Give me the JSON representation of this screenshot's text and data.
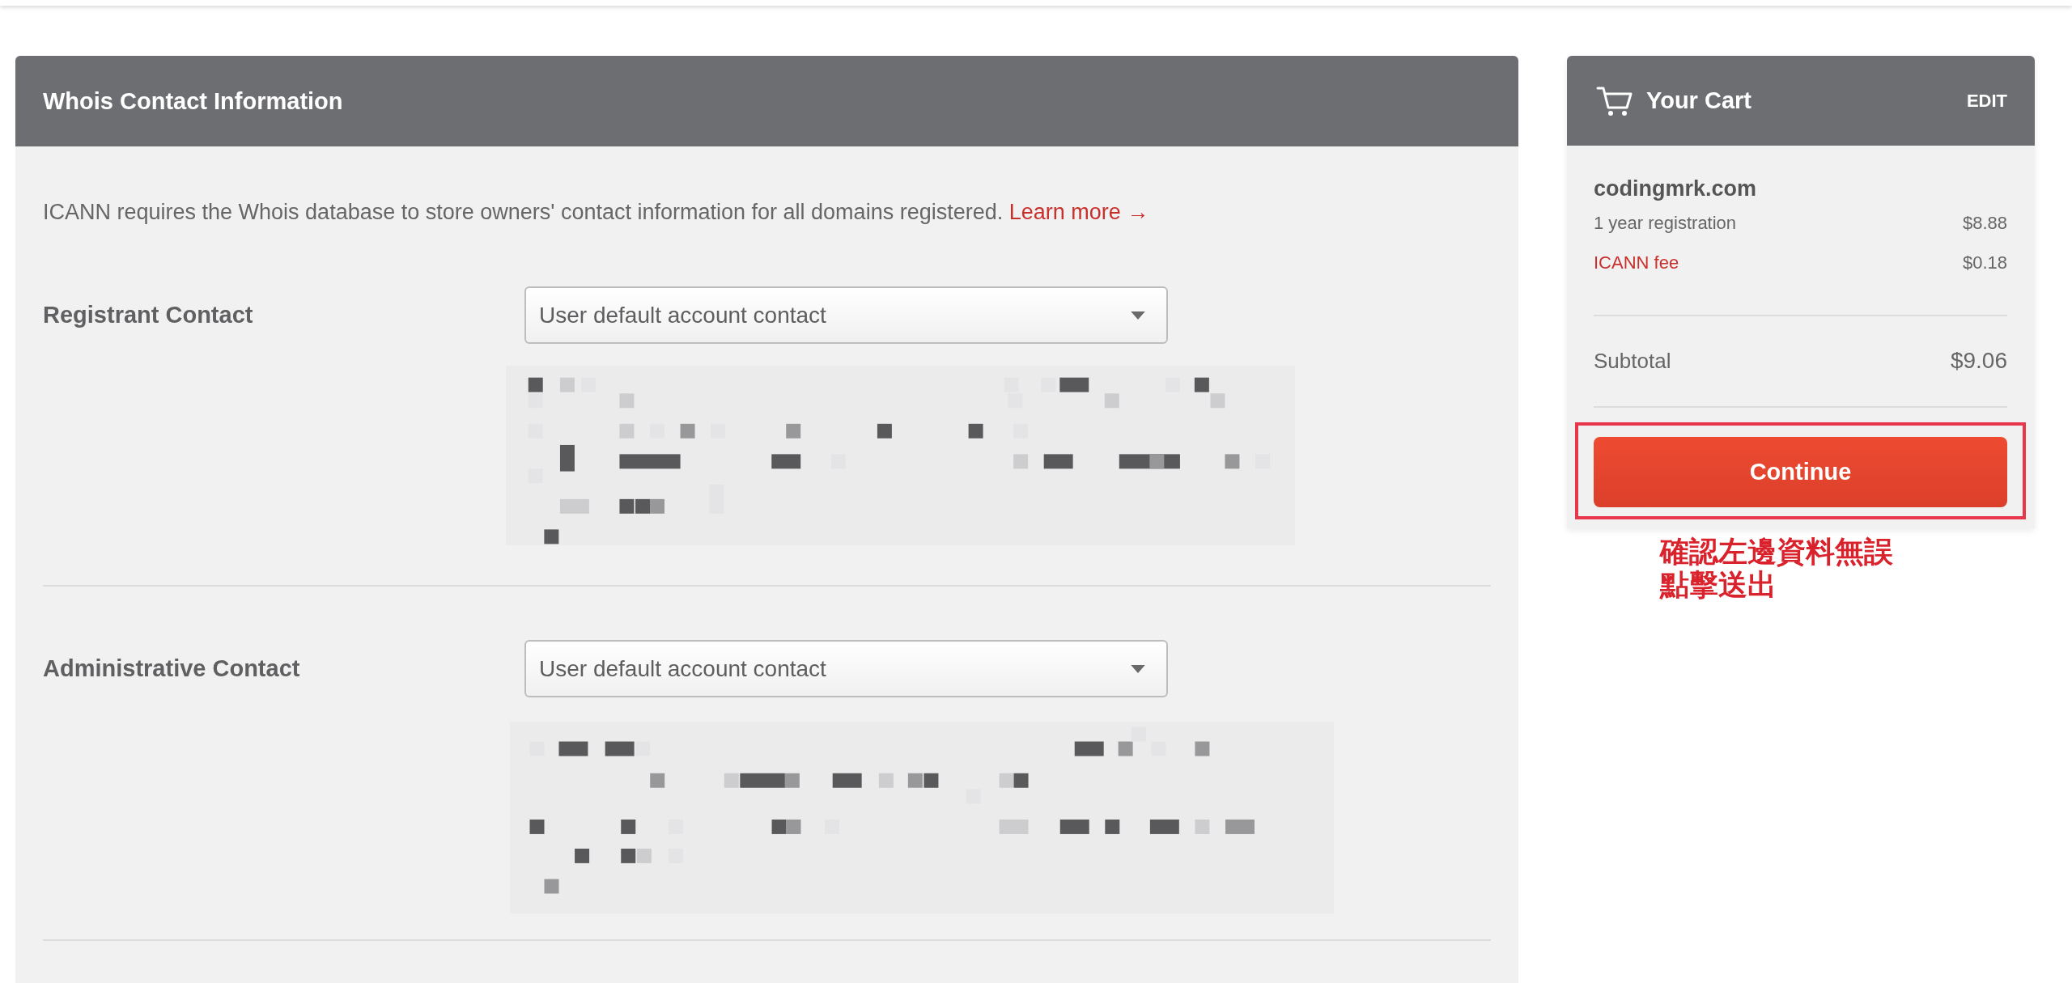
{
  "whois_panel": {
    "title": "Whois Contact Information",
    "intro": {
      "text": "ICANN requires the Whois database to store owners' contact information for all domains registered.",
      "link": "Learn more →"
    },
    "contacts": [
      {
        "label": "Registrant Contact",
        "select_value": "User default account contact"
      },
      {
        "label": "Administrative Contact",
        "select_value": "User default account contact"
      }
    ]
  },
  "cart": {
    "title": "Your Cart",
    "edit": "EDIT",
    "items": [
      {
        "domain": "codingmrk.com",
        "lines": [
          {
            "kind": "charge",
            "label": "1 year registration",
            "price": "$8.88"
          },
          {
            "kind": "fee",
            "label": "ICANN fee",
            "price": "$0.18"
          }
        ]
      }
    ],
    "subtotal": {
      "label": "Subtotal",
      "amount": "$9.06"
    },
    "continue_button": "Continue"
  },
  "annotation": {
    "lines": [
      "確認左邊資料無誤",
      "點擊送出"
    ]
  }
}
